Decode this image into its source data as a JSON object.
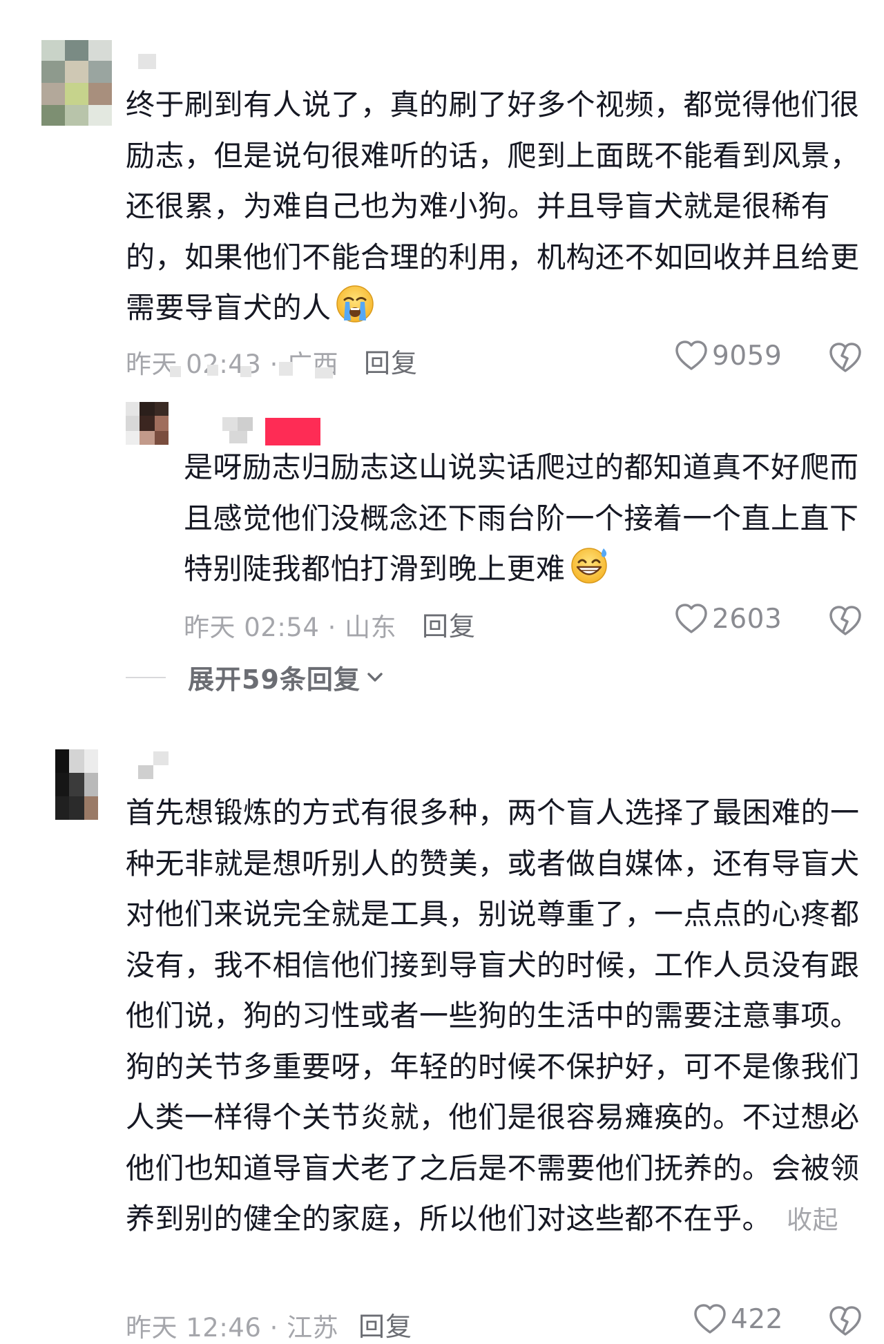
{
  "comments": [
    {
      "text": "终于刷到有人说了，真的刷了好多个视频，都觉得他们很励志，但是说句很难听的话，爬到上面既不能看到风景，还很累，为难自己也为难小狗。并且导盲犬就是很稀有的，如果他们不能合理的利用，机构还不如回收并且给更需要导盲犬的人",
      "emoji": "loudly-crying-face-emoji",
      "meta": "昨天 02:43 · 广西",
      "reply_label": "回复",
      "likes": "9059",
      "reply": {
        "text": "是呀励志归励志这山说实话爬过的都知道真不好爬而且感觉他们没概念还下雨台阶一个接着一个直上直下特别陡我都怕打滑到晚上更难",
        "emoji": "grinning-face-with-sweat-emoji",
        "meta": "昨天 02:54 · 山东",
        "reply_label": "回复",
        "likes": "2603"
      },
      "expand_label": "展开59条回复"
    },
    {
      "text": "首先想锻炼的方式有很多种，两个盲人选择了最困难的一种无非就是想听别人的赞美，或者做自媒体，还有导盲犬对他们来说完全就是工具，别说尊重了，一点点的心疼都没有，我不相信他们接到导盲犬的时候，工作人员没有跟他们说，狗的习性或者一些狗的生活中的需要注意事项。狗的关节多重要呀，年轻的时候不保护好，可不是像我们人类一样得个关节炎就，他们是很容易瘫痪的。不过想必他们也知道导盲犬老了之后是不需要他们抚养的。会被领养到别的健全的家庭，所以他们对这些都不在乎。",
      "collapse_label": "收起",
      "meta": "昨天 12:46 · 江苏",
      "reply_label": "回复",
      "likes": "422"
    }
  ],
  "icons": {
    "like": "heart-outline-icon",
    "dislike": "broken-heart-icon",
    "expand": "chevron-down-icon"
  },
  "colors": {
    "text": "#161823",
    "meta": "#a5a6ab",
    "action": "#6b6d73",
    "badge": "#fe2c55"
  }
}
